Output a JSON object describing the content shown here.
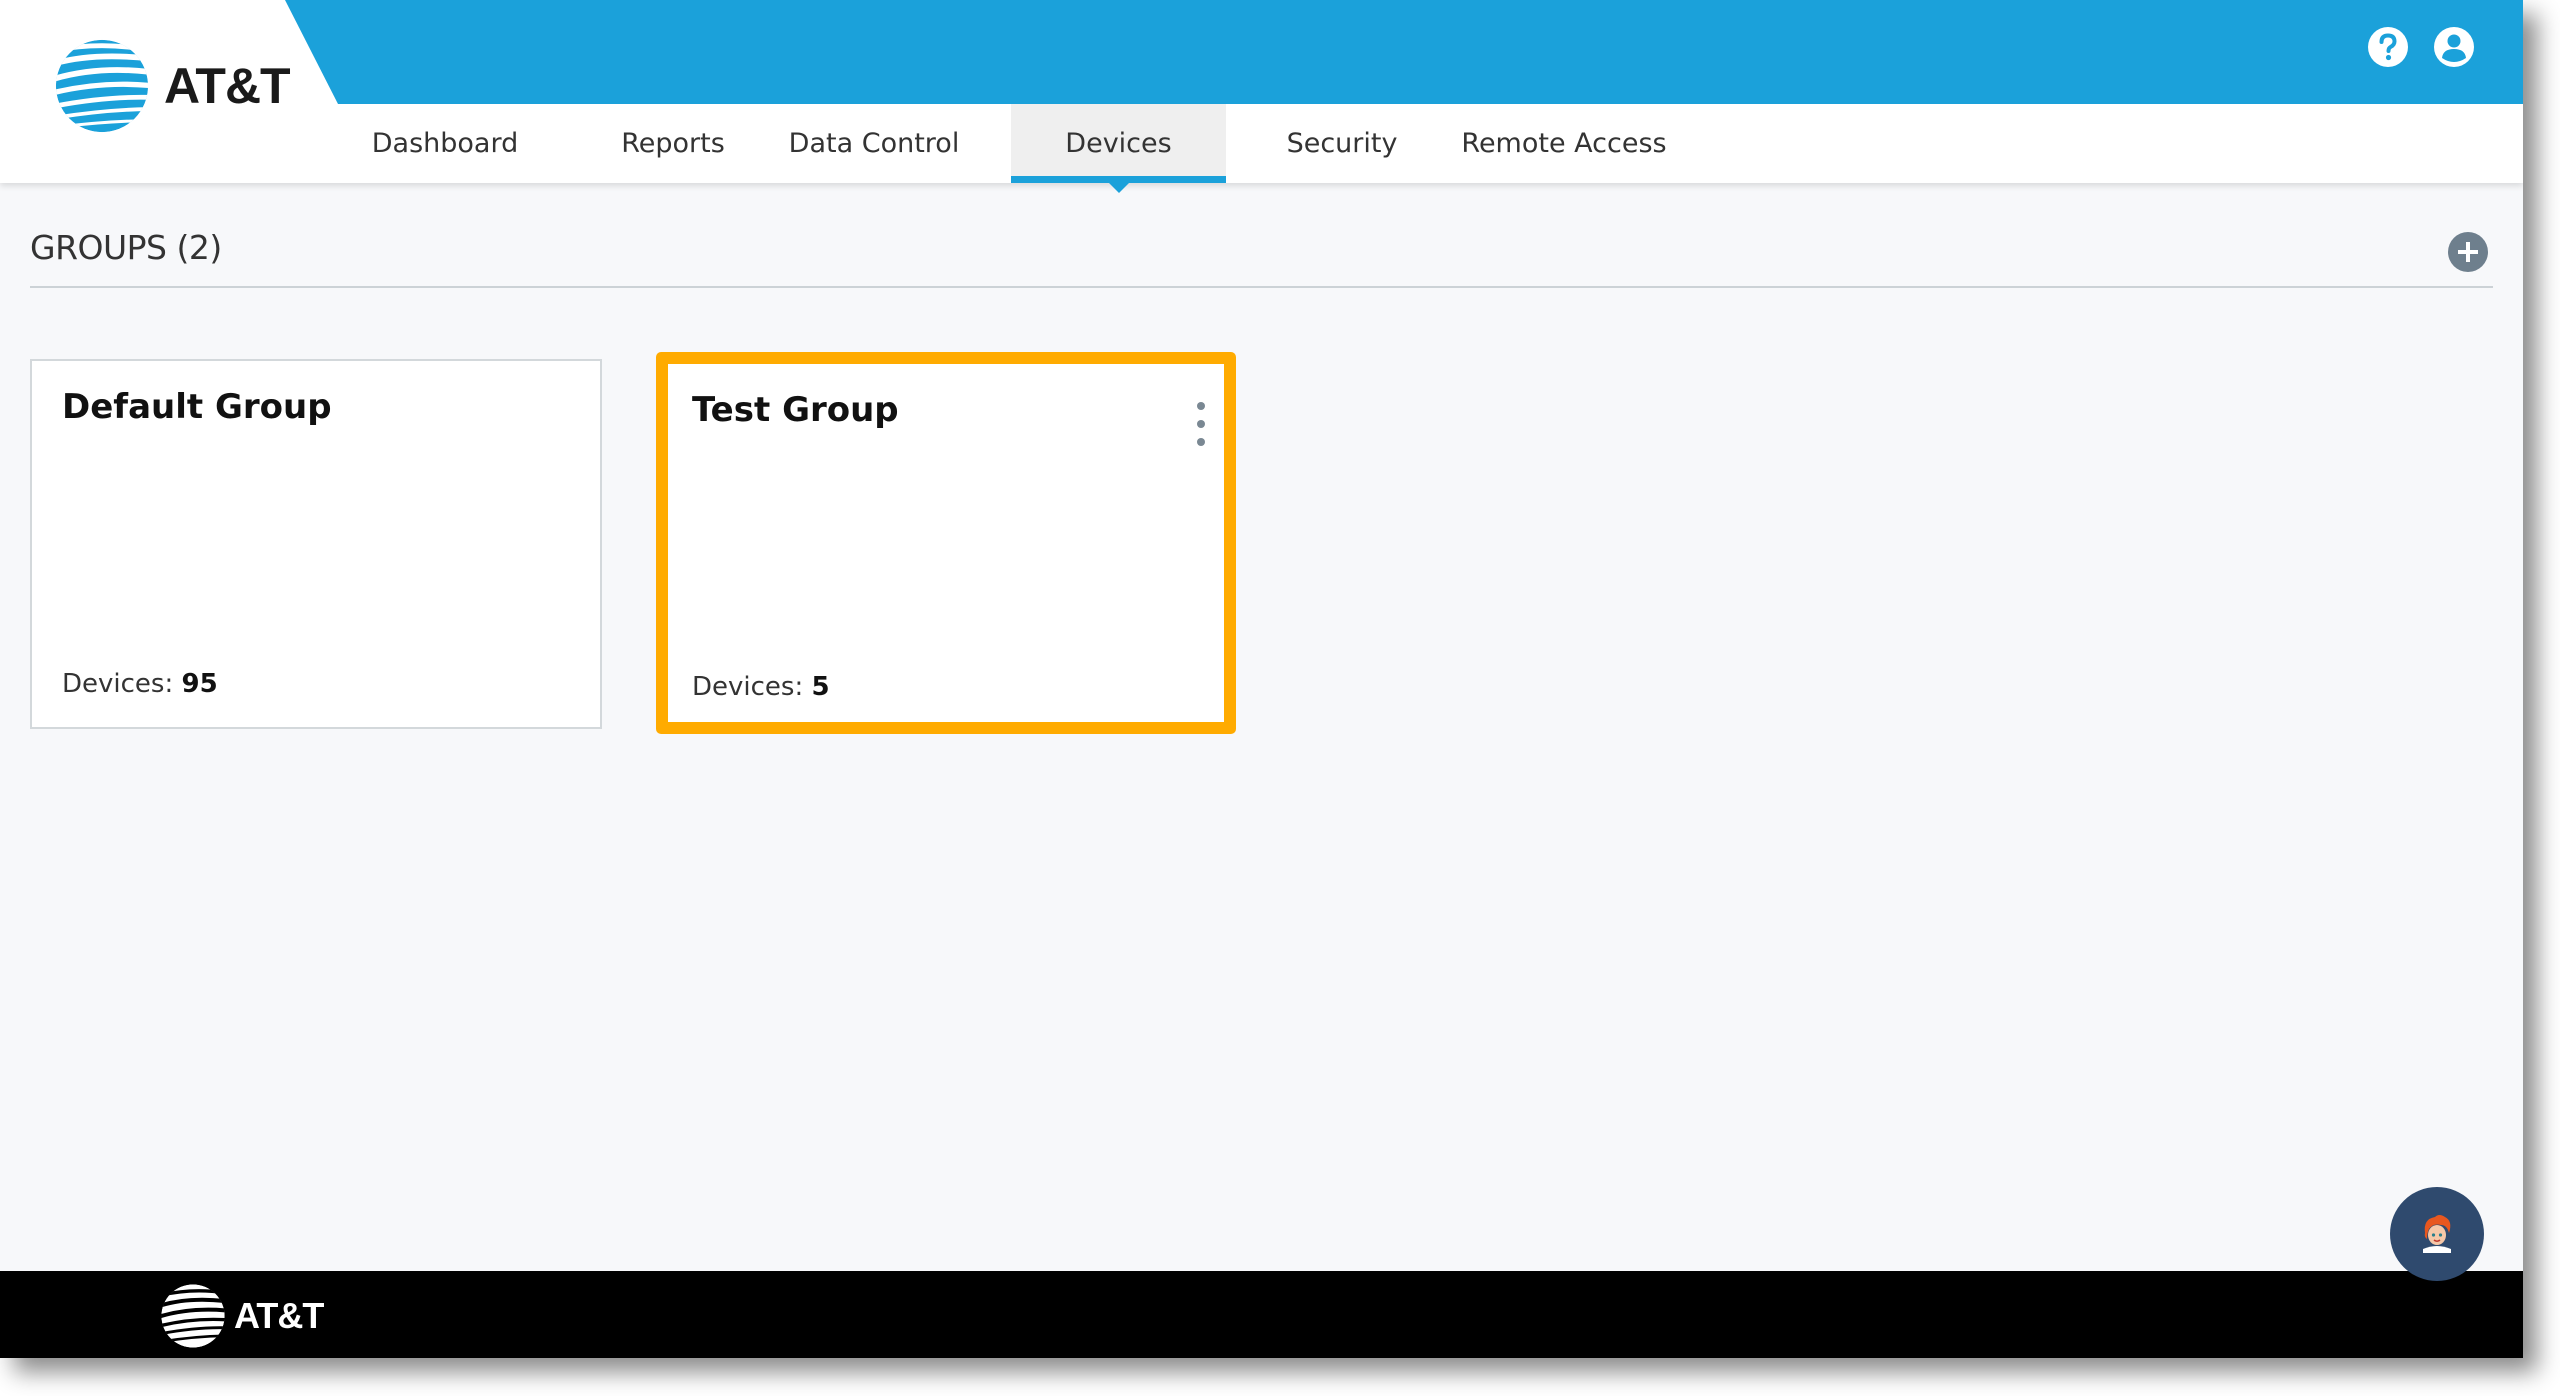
{
  "header": {
    "brand": "AT&T",
    "brand_color": "#1ba1da",
    "icons": [
      {
        "name": "help-icon",
        "label": "?"
      },
      {
        "name": "user-account-icon",
        "label": "account"
      }
    ]
  },
  "nav": {
    "tabs": [
      {
        "label": "Dashboard",
        "active": false
      },
      {
        "label": "Reports",
        "active": false
      },
      {
        "label": "Data Control",
        "active": false
      },
      {
        "label": "Devices",
        "active": true
      },
      {
        "label": "Security",
        "active": false
      },
      {
        "label": "Remote Access",
        "active": false
      }
    ]
  },
  "groups": {
    "title": "GROUPS (2)",
    "add_icon": "plus-circle-icon",
    "cards": [
      {
        "name": "Default Group",
        "devices_label": "Devices:",
        "devices_count": "95",
        "selected": false
      },
      {
        "name": "Test Group",
        "devices_label": "Devices:",
        "devices_count": "5",
        "selected": true,
        "highlight_color": "#ffab00"
      }
    ]
  },
  "footer": {
    "brand": "AT&T"
  },
  "chat": {
    "icon": "chat-assistant-avatar-icon"
  }
}
